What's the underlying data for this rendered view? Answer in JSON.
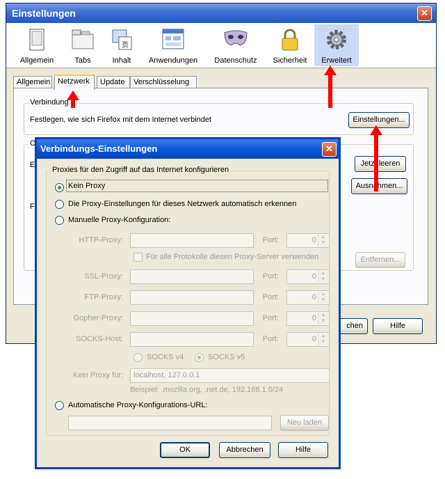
{
  "main_window": {
    "title": "Einstellungen",
    "close_symbol": "✕",
    "toolbar": [
      {
        "label": "Allgemein",
        "icon": "window-icon"
      },
      {
        "label": "Tabs",
        "icon": "tabs-icon"
      },
      {
        "label": "Inhalt",
        "icon": "content-icon"
      },
      {
        "label": "Anwendungen",
        "icon": "applications-icon"
      },
      {
        "label": "Datenschutz",
        "icon": "mask-icon"
      },
      {
        "label": "Sicherheit",
        "icon": "lock-icon"
      },
      {
        "label": "Erweitert",
        "icon": "gear-icon"
      }
    ],
    "tabs": [
      "Allgemein",
      "Netzwerk",
      "Update",
      "Verschlüsselung"
    ],
    "connection": {
      "title": "Verbindung",
      "description": "Festlegen, wie sich Firefox mit dem Internet verbindet",
      "settings_button": "Einstellungen..."
    },
    "offline": {
      "title_fragment": "O",
      "line1_fragment": "E",
      "line2_fragment": "F",
      "clear_button": "Jetzt leeren",
      "exceptions_button": "Ausnahmen...",
      "remove_button": "Entfernen..."
    },
    "cancel_fragment": "chen",
    "help_button": "Hilfe"
  },
  "dialog": {
    "title": "Verbindungs-Einstellungen",
    "close_symbol": "✕",
    "group_title": "Proxies für den Zugriff auf das Internet konfigurieren",
    "options": [
      {
        "label": "Kein Proxy",
        "checked": true
      },
      {
        "label": "Die Proxy-Einstellungen für dieses Netzwerk automatisch erkennen",
        "checked": false
      },
      {
        "label": "Manuelle Proxy-Konfiguration:",
        "checked": false
      }
    ],
    "port_label": "Port:",
    "proxies": [
      {
        "label": "HTTP-Proxy:",
        "value": "",
        "port": "0"
      },
      {
        "label": "SSL-Proxy:",
        "value": "",
        "port": "0"
      },
      {
        "label": "FTP-Proxy:",
        "value": "",
        "port": "0"
      },
      {
        "label": "Gopher-Proxy:",
        "value": "",
        "port": "0"
      },
      {
        "label": "SOCKS-Host:",
        "value": "",
        "port": "0"
      }
    ],
    "same_proxy_checkbox": "Für alle Protokolle diesen Proxy-Server verwenden",
    "socks_v4": "SOCKS v4",
    "socks_v5": "SOCKS v5",
    "no_proxy_label": "Kein Proxy für:",
    "no_proxy_value": "localhost, 127.0.0.1",
    "example": "Beispiel: .mozilla.org, .net.de, 192.168.1.0/24",
    "auto_url_label": "Automatische Proxy-Konfigurations-URL:",
    "auto_url_value": "",
    "reload_button": "Neu laden",
    "ok_button": "OK",
    "cancel_button": "Abbrechen",
    "help_button": "Hilfe"
  },
  "colors": {
    "annotation_arrow": "#ff0000",
    "title_bar": "#0a5ad8",
    "group_title": "#0046d5"
  }
}
